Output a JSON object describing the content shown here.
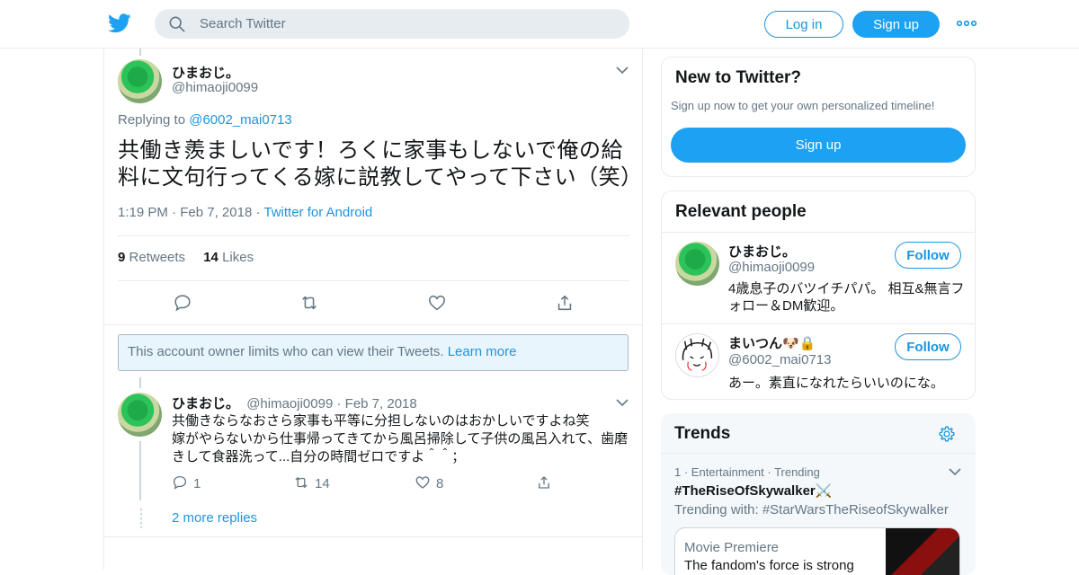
{
  "topbar": {
    "search_placeholder": "Search Twitter",
    "login_label": "Log in",
    "signup_label": "Sign up"
  },
  "main_tweet": {
    "name": "ひまおじ。",
    "handle": "@himaoji0099",
    "replying_prefix": "Replying to",
    "replying_handle": "@6002_mai0713",
    "text": "共働き羨ましいです！ろくに家事もしないで俺の給料に文句行ってくる嫁に説教してやって下さい（笑）",
    "time": "1:19 PM",
    "date": "Feb 7, 2018",
    "source": "Twitter for Android",
    "retweets_count": "9",
    "retweets_label": "Retweets",
    "likes_count": "14",
    "likes_label": "Likes"
  },
  "notice": {
    "text": "This account owner limits who can view their Tweets.",
    "link": "Learn more"
  },
  "reply": {
    "name": "ひまおじ。",
    "handle": "@himaoji0099",
    "date": "Feb 7, 2018",
    "text_line1": "共働きならなおさら家事も平等に分担しないのはおかしいですよね笑",
    "text_line2": "嫁がやらないから仕事帰ってきてから風呂掃除して子供の風呂入れて、歯磨きして食器洗って...自分の時間ゼロですよ＾＾；",
    "reply_count": "1",
    "retweet_count": "14",
    "like_count": "8",
    "more_replies": "2 more replies"
  },
  "new_to_twitter": {
    "title": "New to Twitter?",
    "subtitle": "Sign up now to get your own personalized timeline!",
    "signup_label": "Sign up"
  },
  "relevant_people": {
    "title": "Relevant people",
    "people": [
      {
        "name": "ひまおじ。",
        "handle": "@himaoji0099",
        "bio": "4歳息子のバツイチパパ。 相互&無言フォロー＆DM歓迎。",
        "follow_label": "Follow"
      },
      {
        "name": "まいつん🐶🔒",
        "handle": "@6002_mai0713",
        "bio": "あー。素直になれたらいいのにな。",
        "follow_label": "Follow"
      }
    ]
  },
  "trends": {
    "title": "Trends",
    "items": [
      {
        "rank": "1",
        "category": "Entertainment",
        "status": "Trending",
        "name": "#TheRiseOfSkywalker⚔️",
        "trending_with": "Trending with: #StarWarsTheRiseofSkywalker",
        "card_title": "Movie Premiere",
        "card_desc": "The fandom's force is strong"
      }
    ]
  },
  "colors": {
    "brand": "#1da1f2",
    "link": "#1b95e0",
    "secondary_text": "#657786",
    "border": "#e6ecf0"
  },
  "icons": [
    "twitter-bird-icon",
    "search-icon",
    "more-dots-icon",
    "chevron-down-icon",
    "reply-icon",
    "retweet-icon",
    "like-icon",
    "share-icon",
    "gear-icon"
  ]
}
